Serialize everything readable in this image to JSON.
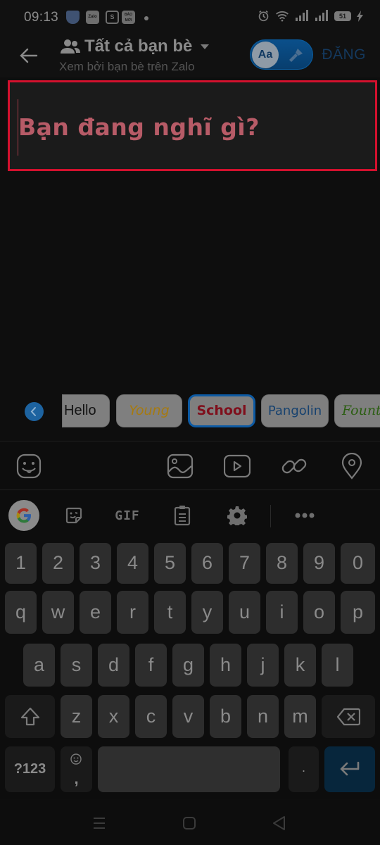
{
  "status_bar": {
    "time": "09:13",
    "notification_icons": [
      "shield-app",
      "zalo",
      "shopee",
      "bao-moi"
    ],
    "zalo_label": "Zalo",
    "shop_label": "S",
    "bao_label": "BÁO MỚI",
    "battery": "51",
    "charging": true
  },
  "header": {
    "audience_title": "Tất cả bạn bè",
    "audience_subtitle": "Xem bởi bạn bè trên Zalo",
    "toggle_label": "Aa",
    "post_label": "ĐĂNG"
  },
  "composer": {
    "placeholder": "Bạn đang nghĩ gì?",
    "highlight_color": "#d3112e"
  },
  "font_styles": {
    "selected": "School",
    "items": [
      {
        "label": "Hello"
      },
      {
        "label": "Young"
      },
      {
        "label": "School"
      },
      {
        "label": "Pangolin"
      },
      {
        "label": "Fountain"
      }
    ]
  },
  "attach_bar": {
    "items": [
      "sticker",
      "photo",
      "video",
      "link",
      "location"
    ]
  },
  "keyboard_toolbar": {
    "gif_label": "GIF",
    "items": [
      "google",
      "sticker",
      "gif",
      "clipboard",
      "settings",
      "more"
    ]
  },
  "keyboard": {
    "row_numbers": [
      "1",
      "2",
      "3",
      "4",
      "5",
      "6",
      "7",
      "8",
      "9",
      "0"
    ],
    "row_1": [
      "q",
      "w",
      "e",
      "r",
      "t",
      "y",
      "u",
      "i",
      "o",
      "p"
    ],
    "row_2": [
      "a",
      "s",
      "d",
      "f",
      "g",
      "h",
      "j",
      "k",
      "l"
    ],
    "row_3": [
      "z",
      "x",
      "c",
      "v",
      "b",
      "n",
      "m"
    ],
    "symbols_label": "?123",
    "comma_label": ",",
    "period_label": "."
  }
}
